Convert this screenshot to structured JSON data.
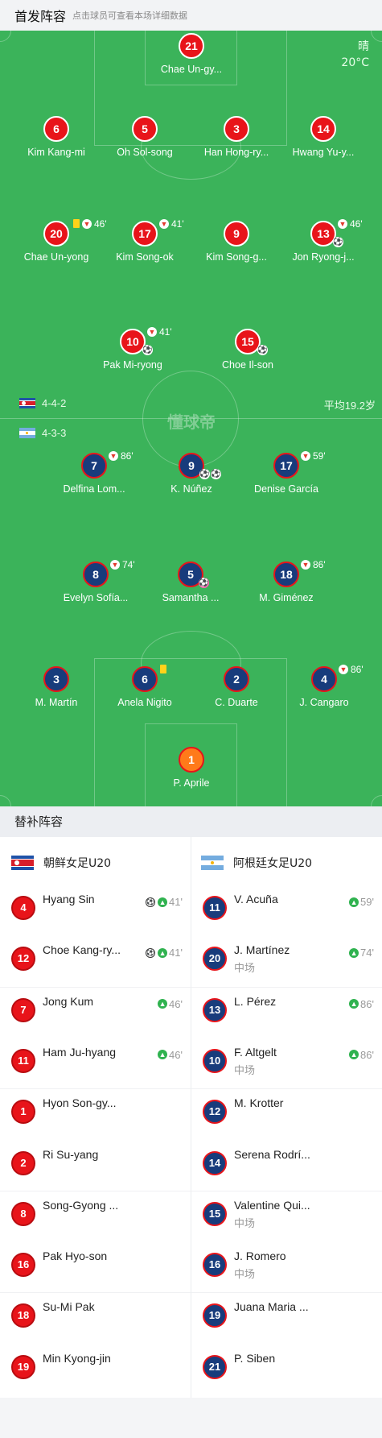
{
  "header": {
    "title": "首发阵容",
    "hint": "点击球员可查看本场详细数据"
  },
  "weather": {
    "condition": "晴",
    "temperature": "20°C"
  },
  "watermark": "懂球帝",
  "home": {
    "formation": "4-4-2",
    "average_age": "平均19.2岁",
    "players": {
      "p21": {
        "number": "21",
        "name": "Chae Un-gy..."
      },
      "p6": {
        "number": "6",
        "name": "Kim Kang-mi"
      },
      "p5": {
        "number": "5",
        "name": "Oh Sol-song"
      },
      "p3": {
        "number": "3",
        "name": "Han Hong-ry..."
      },
      "p14": {
        "number": "14",
        "name": "Hwang Yu-y..."
      },
      "p20": {
        "number": "20",
        "name": "Chae Un-yong",
        "sub_minute": "46'"
      },
      "p17": {
        "number": "17",
        "name": "Kim Song-ok",
        "sub_minute": "41'"
      },
      "p9": {
        "number": "9",
        "name": "Kim Song-g..."
      },
      "p13": {
        "number": "13",
        "name": "Jon Ryong-j...",
        "sub_minute": "46'"
      },
      "p10": {
        "number": "10",
        "name": "Pak Mi-ryong",
        "sub_minute": "41'"
      },
      "p15": {
        "number": "15",
        "name": "Choe Il-son"
      }
    }
  },
  "away": {
    "formation": "4-3-3",
    "players": {
      "p7": {
        "number": "7",
        "name": "Delfina Lom...",
        "sub_minute": "86'"
      },
      "p9": {
        "number": "9",
        "name": "K. Núñez"
      },
      "p17": {
        "number": "17",
        "name": "Denise García",
        "sub_minute": "59'"
      },
      "p8": {
        "number": "8",
        "name": "Evelyn Sofía...",
        "sub_minute": "74'"
      },
      "p5": {
        "number": "5",
        "name": "Samantha ..."
      },
      "p18": {
        "number": "18",
        "name": "M. Giménez",
        "sub_minute": "86'"
      },
      "p3": {
        "number": "3",
        "name": "M. Martín"
      },
      "p6": {
        "number": "6",
        "name": "Anela Nigito"
      },
      "p2": {
        "number": "2",
        "name": "C. Duarte"
      },
      "p4": {
        "number": "4",
        "name": "J. Cangaro",
        "sub_minute": "86'"
      },
      "p1": {
        "number": "1",
        "name": "P. Aprile"
      }
    }
  },
  "subs": {
    "title": "替补阵容",
    "home_team": "朝鲜女足U20",
    "away_team": "阿根廷女足U20",
    "home": [
      {
        "number": "4",
        "name": "Hyang Sin",
        "minute": "41'"
      },
      {
        "number": "12",
        "name": "Choe Kang-ry...",
        "minute": "41'"
      },
      {
        "number": "7",
        "name": "Jong Kum",
        "minute": "46'"
      },
      {
        "number": "11",
        "name": "Ham Ju-hyang",
        "minute": "46'"
      },
      {
        "number": "1",
        "name": "Hyon Son-gy..."
      },
      {
        "number": "2",
        "name": "Ri Su-yang"
      },
      {
        "number": "8",
        "name": "Song-Gyong ..."
      },
      {
        "number": "16",
        "name": "Pak Hyo-son"
      },
      {
        "number": "18",
        "name": "Su-Mi Pak"
      },
      {
        "number": "19",
        "name": "Min Kyong-jin"
      }
    ],
    "away": [
      {
        "number": "11",
        "name": "V. Acuña",
        "minute": "59'"
      },
      {
        "number": "20",
        "name": "J. Martínez",
        "position": "中场",
        "minute": "74'"
      },
      {
        "number": "13",
        "name": "L. Pérez",
        "minute": "86'"
      },
      {
        "number": "10",
        "name": "F. Altgelt",
        "position": "中场",
        "minute": "86'"
      },
      {
        "number": "12",
        "name": "M. Krotter"
      },
      {
        "number": "14",
        "name": "Serena Rodrí..."
      },
      {
        "number": "15",
        "name": "Valentine Qui...",
        "position": "中场"
      },
      {
        "number": "16",
        "name": "J. Romero",
        "position": "中场"
      },
      {
        "number": "19",
        "name": "Juana Maria ..."
      },
      {
        "number": "21",
        "name": "P. Siben"
      }
    ]
  },
  "colors": {
    "pitch": "#3bb35a",
    "home": "#e8141a",
    "away": "#183c7c",
    "goalkeeper": "#ff7a1a",
    "sub_in": "#2fb24f",
    "yellow_card": "#ffd21a"
  },
  "icons": {
    "sub_out": "arrow-down-icon",
    "sub_in": "arrow-up-icon",
    "goal": "football-icon",
    "own_goal": "football-pink-icon",
    "card": "yellow-card-icon"
  }
}
